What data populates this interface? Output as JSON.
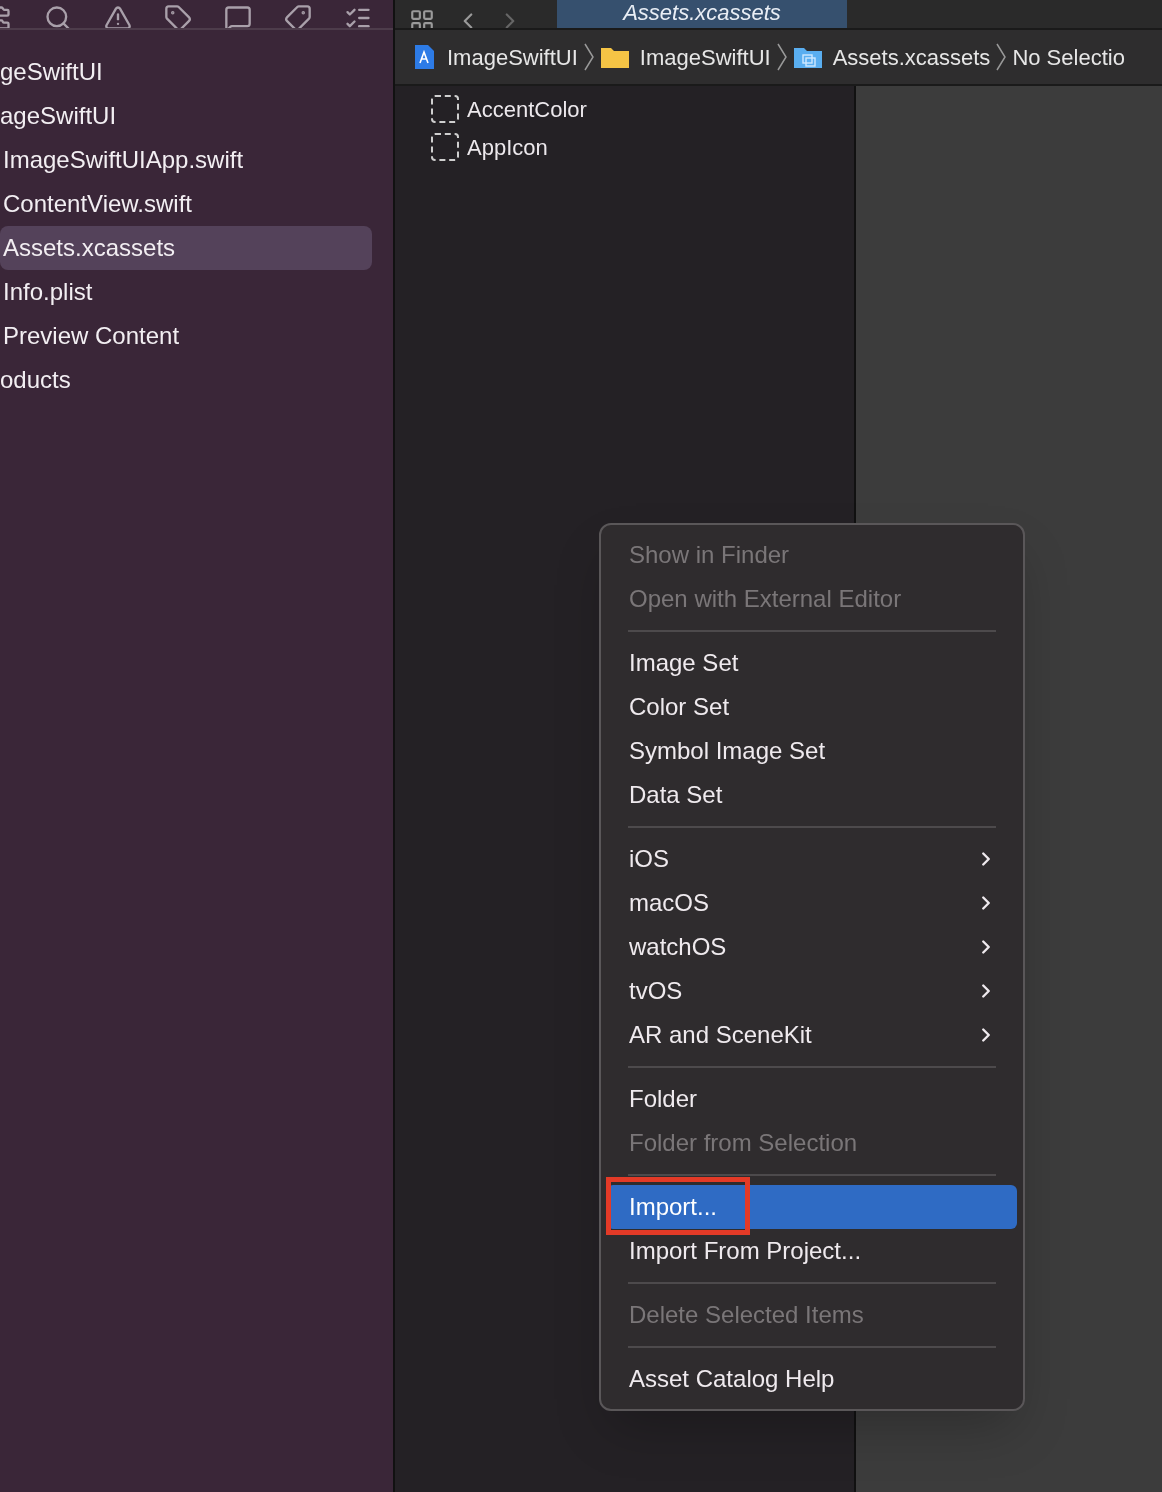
{
  "sidebar": {
    "items": [
      {
        "label": "geSwiftUI",
        "selected": false,
        "children": [
          {
            "label": "ageSwiftUI",
            "selected": false,
            "children": [
              {
                "label": "ImageSwiftUIApp.swift",
                "selected": false
              },
              {
                "label": "ContentView.swift",
                "selected": false
              },
              {
                "label": "Assets.xcassets",
                "selected": true
              },
              {
                "label": "Info.plist",
                "selected": false
              },
              {
                "label": "Preview Content",
                "selected": false
              }
            ]
          },
          {
            "label": "oducts",
            "selected": false
          }
        ]
      }
    ]
  },
  "editor_tab": {
    "label": "Assets.xcassets",
    "selected": true
  },
  "breadcrumb": [
    {
      "label": "ImageSwiftUI",
      "kind": "project"
    },
    {
      "label": "ImageSwiftUI",
      "kind": "folder"
    },
    {
      "label": "Assets.xcassets",
      "kind": "catalog"
    },
    {
      "label": "No Selectio",
      "kind": "text"
    }
  ],
  "assets": [
    "AccentColor",
    "AppIcon"
  ],
  "context_menu": {
    "items": [
      {
        "kind": "item",
        "label": "Show in Finder",
        "disabled": true,
        "selected": false
      },
      {
        "kind": "item",
        "label": "Open with External Editor",
        "disabled": true,
        "selected": false
      },
      {
        "kind": "separator"
      },
      {
        "kind": "item",
        "label": "Image Set",
        "disabled": false,
        "selected": false
      },
      {
        "kind": "item",
        "label": "Color Set",
        "disabled": false,
        "selected": false
      },
      {
        "kind": "item",
        "label": "Symbol Image Set",
        "disabled": false,
        "selected": false
      },
      {
        "kind": "item",
        "label": "Data Set",
        "disabled": false,
        "selected": false
      },
      {
        "kind": "separator"
      },
      {
        "kind": "submenu",
        "label": "iOS",
        "disabled": false,
        "selected": false
      },
      {
        "kind": "submenu",
        "label": "macOS",
        "disabled": false,
        "selected": false
      },
      {
        "kind": "submenu",
        "label": "watchOS",
        "disabled": false,
        "selected": false
      },
      {
        "kind": "submenu",
        "label": "tvOS",
        "disabled": false,
        "selected": false
      },
      {
        "kind": "submenu",
        "label": "AR and SceneKit",
        "disabled": false,
        "selected": false
      },
      {
        "kind": "separator"
      },
      {
        "kind": "item",
        "label": "Folder",
        "disabled": false,
        "selected": false
      },
      {
        "kind": "item",
        "label": "Folder from Selection",
        "disabled": true,
        "selected": false
      },
      {
        "kind": "separator"
      },
      {
        "kind": "item",
        "label": "Import...",
        "disabled": false,
        "selected": true,
        "annotated": true
      },
      {
        "kind": "item",
        "label": "Import From Project...",
        "disabled": false,
        "selected": false
      },
      {
        "kind": "separator"
      },
      {
        "kind": "item",
        "label": "Delete Selected Items",
        "disabled": true,
        "selected": false
      },
      {
        "kind": "separator"
      },
      {
        "kind": "item",
        "label": "Asset Catalog Help",
        "disabled": false,
        "selected": false
      }
    ]
  }
}
